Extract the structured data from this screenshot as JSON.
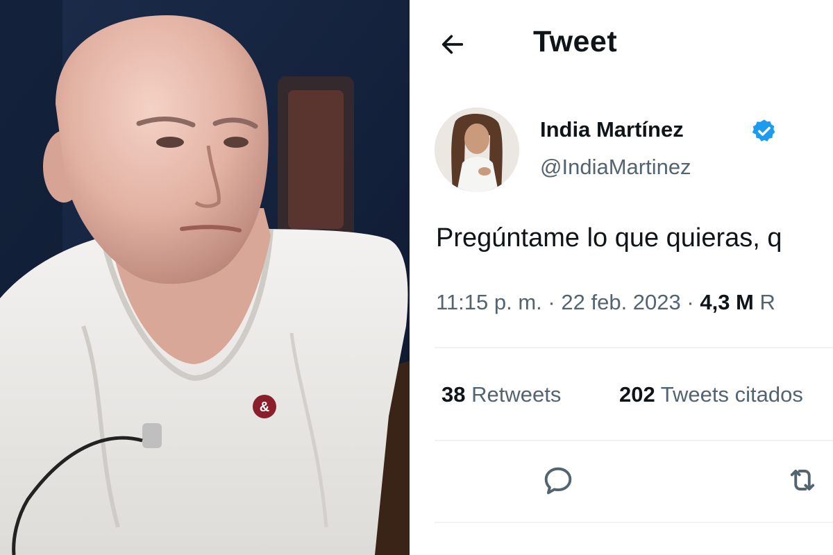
{
  "header": {
    "title": "Tweet"
  },
  "icons": {
    "back": "arrow-left-icon",
    "verified": "verified-badge-icon",
    "reply": "reply-icon",
    "retweet": "retweet-icon"
  },
  "tweet": {
    "author_name": "India Martínez",
    "author_handle": "@IndiaMartinez",
    "text": "Pregúntame lo que quieras, q",
    "time": "11:15 p. m.",
    "separator": "·",
    "date": "22 feb. 2023",
    "views_count": "4,3 M",
    "views_label": "R"
  },
  "stats": {
    "retweets_count": "38",
    "retweets_label": "Retweets",
    "quotes_count": "202",
    "quotes_label": "Tweets citados"
  },
  "colors": {
    "verified_blue": "#1d9bf0",
    "text_primary": "#0f1419",
    "text_secondary": "#536471",
    "divider": "#eff3f4"
  }
}
